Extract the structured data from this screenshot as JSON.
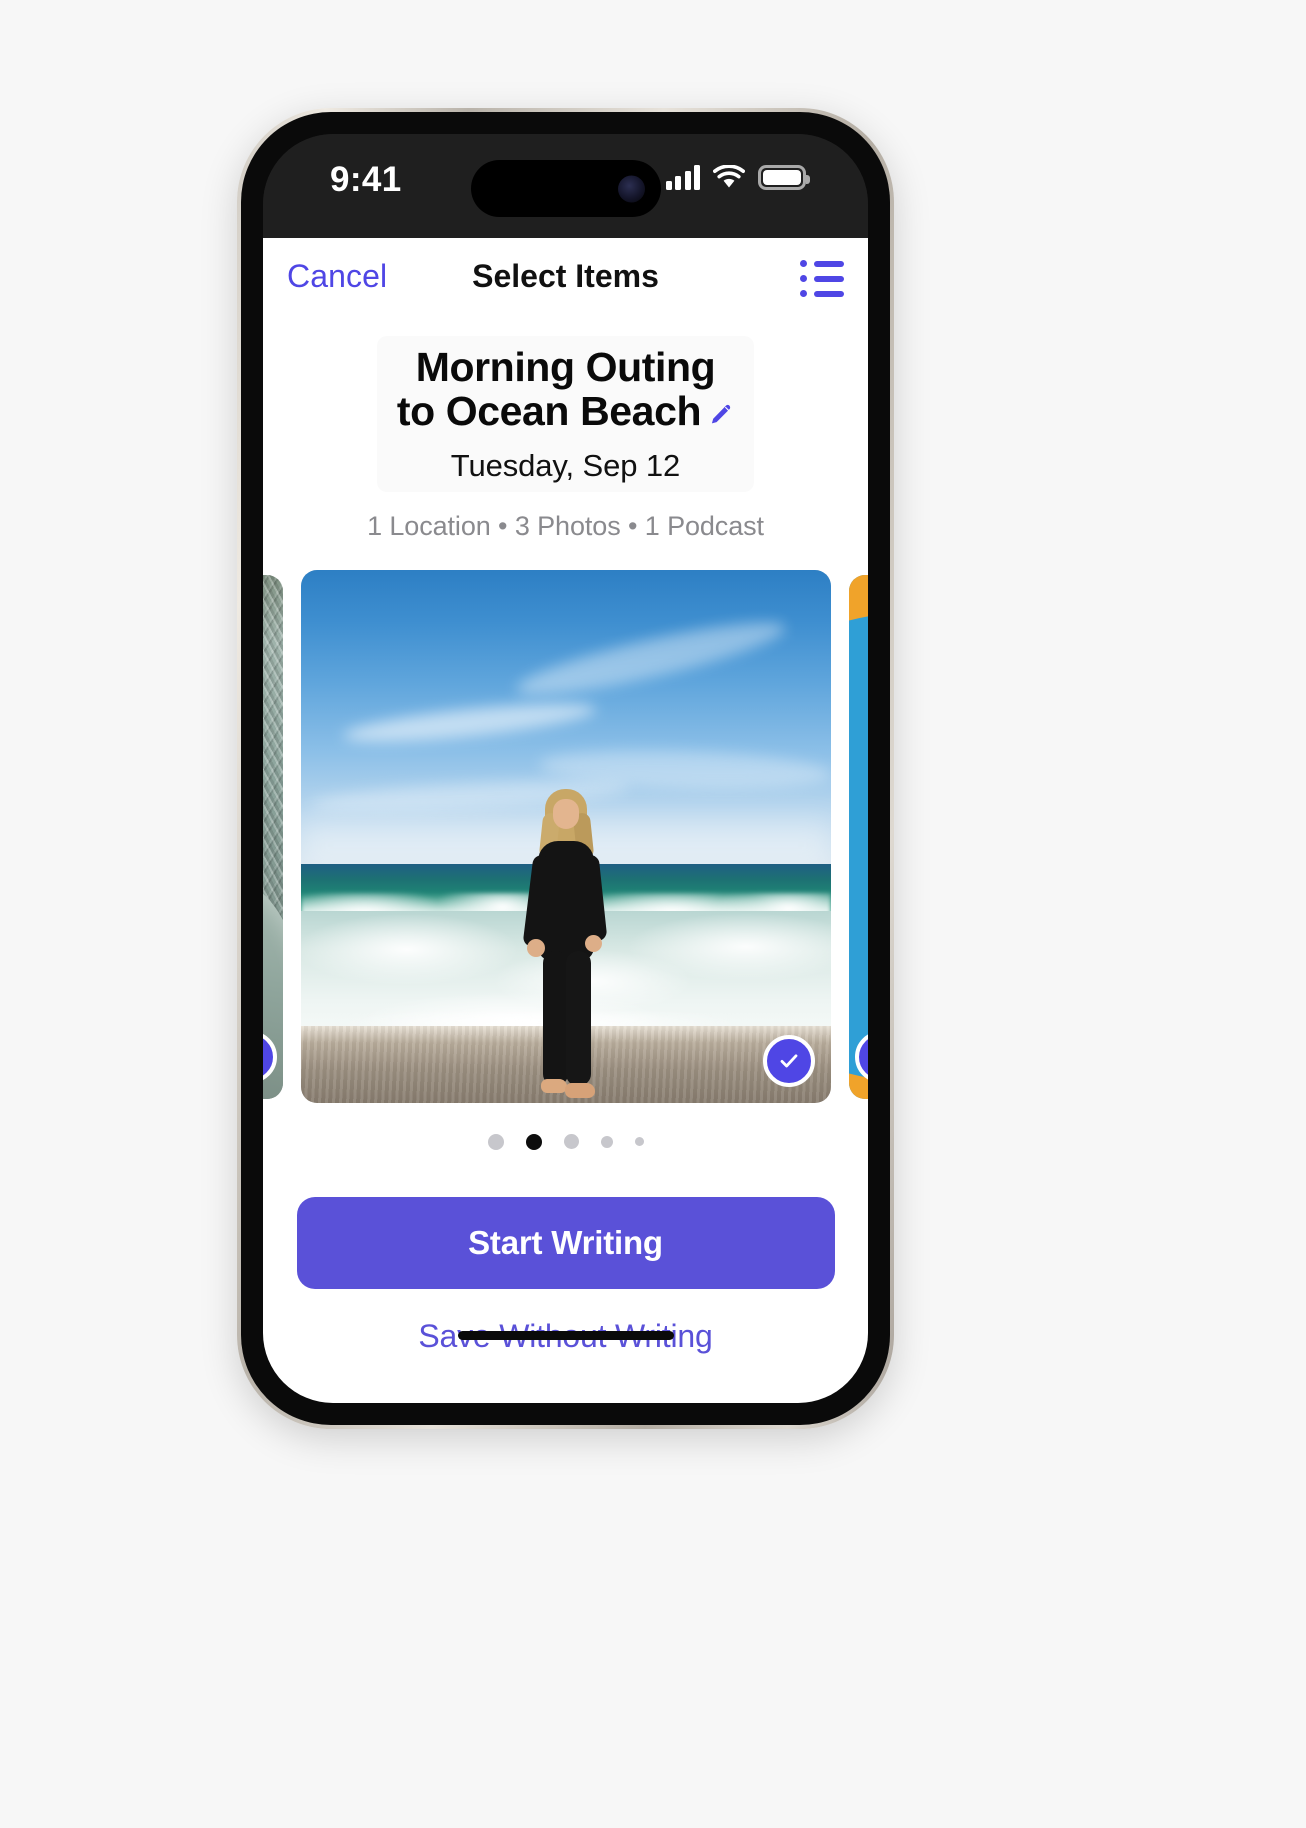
{
  "status_bar": {
    "time": "9:41",
    "cellular_icon": "cellular-bars-icon",
    "wifi_icon": "wifi-icon",
    "battery_icon": "battery-icon"
  },
  "nav": {
    "cancel_label": "Cancel",
    "title": "Select Items",
    "list_icon": "bulleted-list-icon"
  },
  "entry": {
    "title_line1": "Morning Outing",
    "title_line2": "to Ocean Beach",
    "edit_icon": "pencil-icon",
    "date": "Tuesday, Sep 12",
    "meta": "1 Location • 3 Photos • 1 Podcast"
  },
  "carousel": {
    "items": [
      {
        "name": "photo-knit-textile",
        "selected": true,
        "check_icon": "checkmark-circle-icon"
      },
      {
        "name": "photo-beach-runner",
        "selected": true,
        "check_icon": "checkmark-circle-icon"
      },
      {
        "name": "podcast-artwork",
        "selected": true,
        "check_icon": "checkmark-circle-icon"
      }
    ],
    "page_dots": {
      "count": 5,
      "active_index": 1
    }
  },
  "footer": {
    "primary_label": "Start Writing",
    "secondary_label": "Save Without Writing"
  },
  "colors": {
    "accent_purple": "#5a51d8",
    "link_blue": "#4f46e5",
    "meta_gray": "#8a8a8e",
    "dot_inactive": "#c7c7cc",
    "dot_active": "#0d0d0d"
  }
}
